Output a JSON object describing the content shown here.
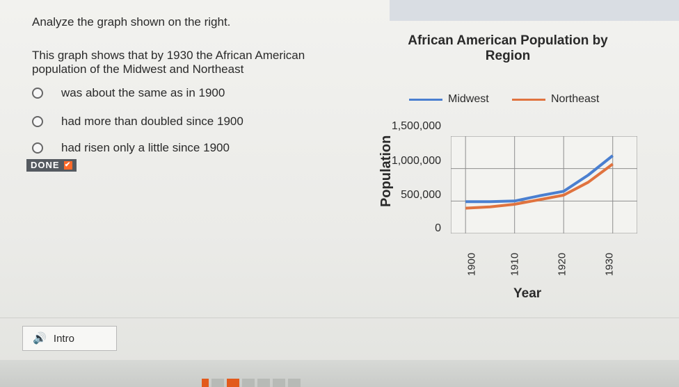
{
  "question": {
    "instruction": "Analyze the graph shown on the right.",
    "prompt": "This graph shows that by 1930 the African American population of the Midwest and Northeast",
    "choices": [
      "was about the same as in 1900",
      "had more than doubled since 1900",
      "had risen only a little since 1900"
    ],
    "done_label": "DONE"
  },
  "audio": {
    "label": "Intro"
  },
  "colors": {
    "midwest": "#4a7fd0",
    "northeast": "#e0733f",
    "done_bg": "#555a60",
    "accent": "#ff6a2a"
  },
  "chart_data": {
    "type": "line",
    "title": "African American Population by Region",
    "xlabel": "Year",
    "ylabel": "Population",
    "x": [
      1900,
      1905,
      1910,
      1915,
      1920,
      1925,
      1930
    ],
    "series": [
      {
        "name": "Midwest",
        "values": [
          490000,
          490000,
          500000,
          580000,
          650000,
          900000,
          1200000
        ]
      },
      {
        "name": "Northeast",
        "values": [
          390000,
          410000,
          450000,
          520000,
          590000,
          790000,
          1070000
        ]
      }
    ],
    "xticks": [
      "1900",
      "1910",
      "1920",
      "1930"
    ],
    "yticks": [
      "0",
      "500,000",
      "1,000,000",
      "1,500,000"
    ],
    "ylim": [
      0,
      1500000
    ],
    "xlim": [
      1897,
      1935
    ],
    "grid": true,
    "legend": "top"
  }
}
